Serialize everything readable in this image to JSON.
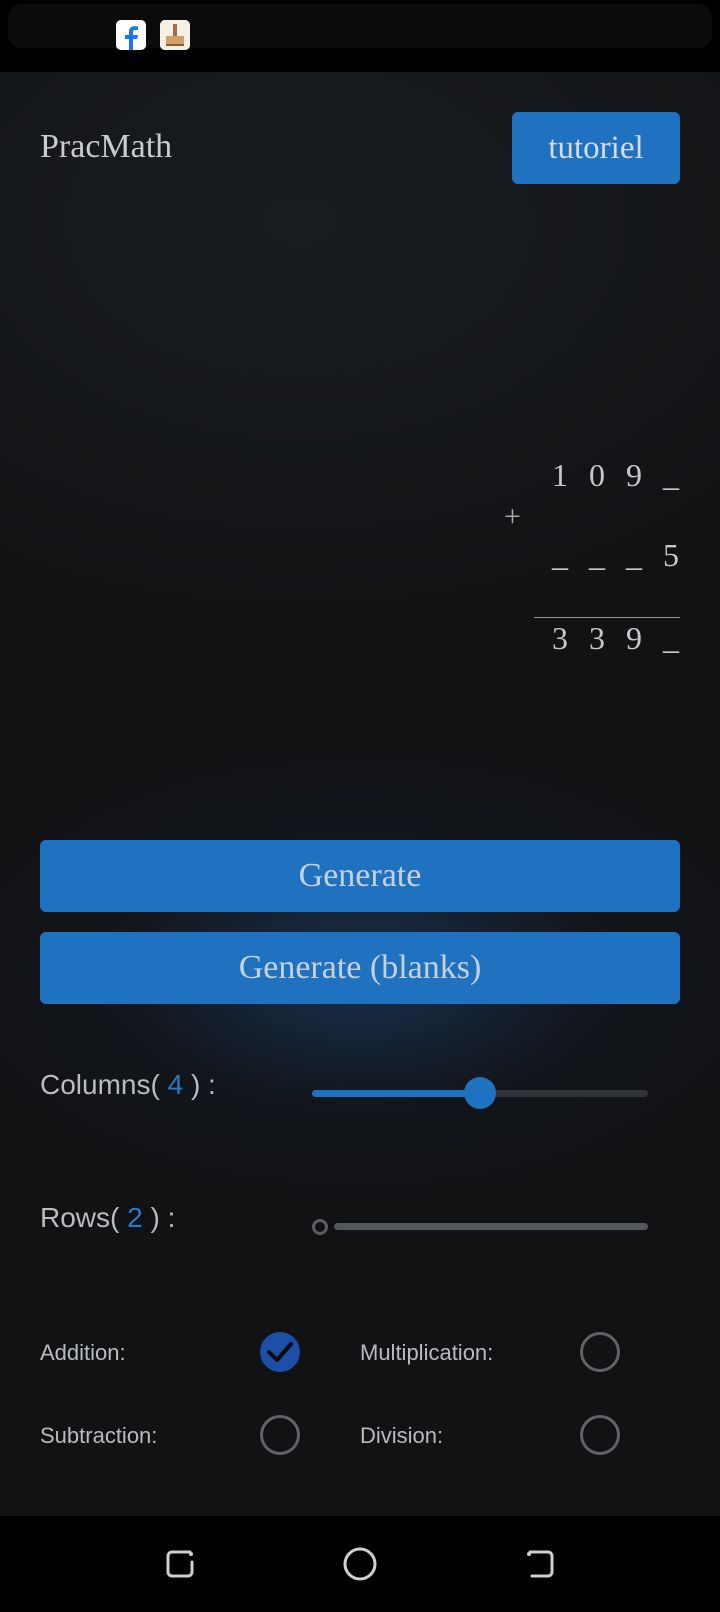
{
  "status_bar": {
    "icons": [
      "facebook-icon",
      "notification-app-icon"
    ]
  },
  "header": {
    "title": "PracMath",
    "tutorial_button": "tutoriel"
  },
  "problem": {
    "operator": "+",
    "row1": [
      "1",
      "0",
      "9",
      "_"
    ],
    "row2": [
      "_",
      "_",
      "_",
      "5"
    ],
    "result": [
      "3",
      "3",
      "9",
      "_"
    ]
  },
  "buttons": {
    "generate": "Generate",
    "generate_blanks": "Generate (blanks)"
  },
  "settings": {
    "columns_prefix": "Columns(",
    "columns_value": "4",
    "columns_suffix": ") :",
    "columns_fraction": 0.5,
    "rows_prefix": "Rows(",
    "rows_value": "2",
    "rows_suffix": ") :",
    "rows_fraction": 0.0
  },
  "operations": {
    "addition": {
      "label": "Addition:",
      "checked": true
    },
    "multiplication": {
      "label": "Multiplication:",
      "checked": false
    },
    "subtraction": {
      "label": "Subtraction:",
      "checked": false
    },
    "division": {
      "label": "Division:",
      "checked": false
    }
  },
  "nav": {
    "icons": [
      "recent-apps-icon",
      "home-icon",
      "back-icon"
    ]
  },
  "colors": {
    "accent": "#1f72c0",
    "background": "#111214",
    "checked": "#1c4fa7"
  }
}
